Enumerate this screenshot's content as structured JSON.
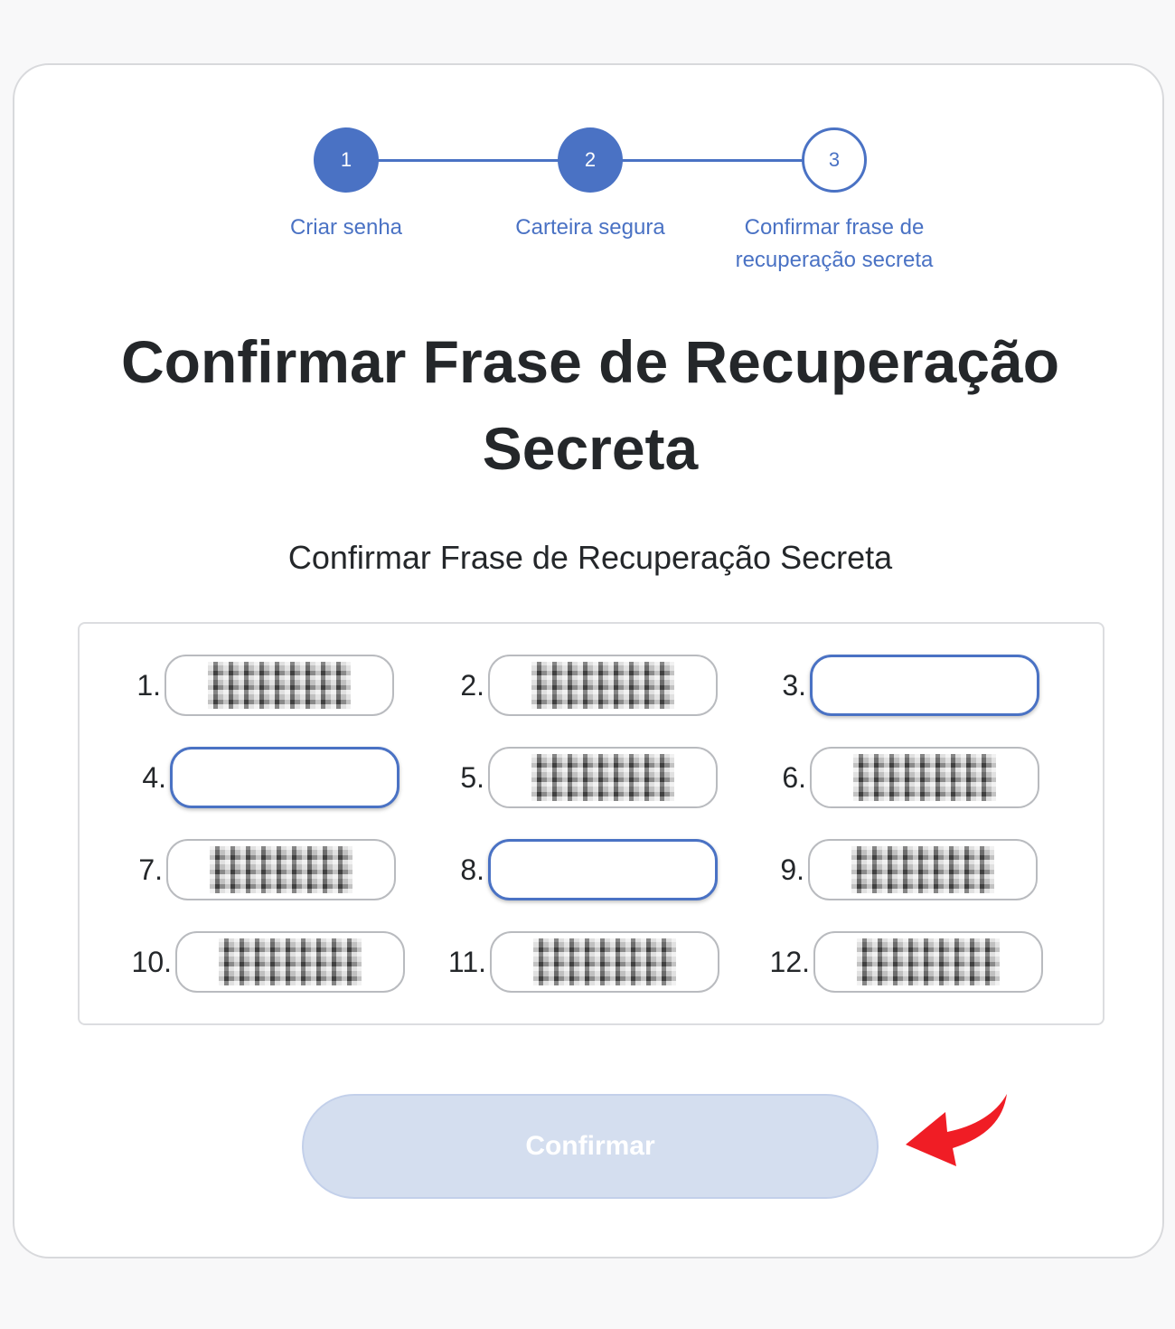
{
  "stepper": {
    "steps": [
      {
        "number": "1",
        "label": "Criar senha",
        "state": "done"
      },
      {
        "number": "2",
        "label": "Carteira segura",
        "state": "done"
      },
      {
        "number": "3",
        "label": "Confirmar frase de recuperação secreta",
        "state": "current"
      }
    ]
  },
  "title": "Confirmar Frase de Recuperação Secreta",
  "subtitle": "Confirmar Frase de Recuperação Secreta",
  "words": [
    {
      "number": "1.",
      "state": "hidden"
    },
    {
      "number": "2.",
      "state": "hidden"
    },
    {
      "number": "3.",
      "state": "empty"
    },
    {
      "number": "4.",
      "state": "empty"
    },
    {
      "number": "5.",
      "state": "hidden"
    },
    {
      "number": "6.",
      "state": "hidden"
    },
    {
      "number": "7.",
      "state": "hidden"
    },
    {
      "number": "8.",
      "state": "empty"
    },
    {
      "number": "9.",
      "state": "hidden"
    },
    {
      "number": "10.",
      "state": "hidden"
    },
    {
      "number": "11.",
      "state": "hidden"
    },
    {
      "number": "12.",
      "state": "hidden"
    }
  ],
  "confirm_button": {
    "label": "Confirmar",
    "enabled": false
  },
  "colors": {
    "accent": "#4a72c4",
    "button_disabled": "#d4deef",
    "annotation_arrow": "#f01d25",
    "text": "#24272a"
  },
  "annotation": {
    "icon": "red-arrow-icon"
  }
}
